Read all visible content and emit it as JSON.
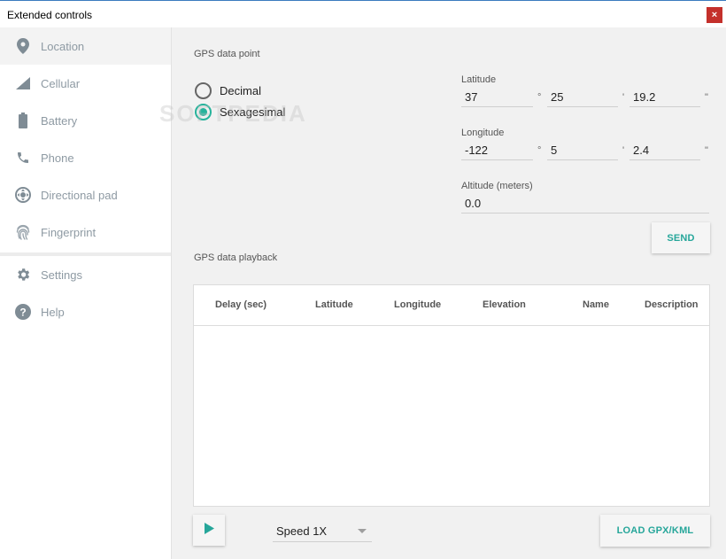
{
  "window": {
    "title": "Extended controls",
    "close_label": "×"
  },
  "sidebar": {
    "items": [
      {
        "label": "Location",
        "icon": "location-pin-icon",
        "active": true
      },
      {
        "label": "Cellular",
        "icon": "signal-icon"
      },
      {
        "label": "Battery",
        "icon": "battery-icon"
      },
      {
        "label": "Phone",
        "icon": "phone-icon"
      },
      {
        "label": "Directional pad",
        "icon": "dpad-icon"
      },
      {
        "label": "Fingerprint",
        "icon": "fingerprint-icon"
      }
    ],
    "secondary": [
      {
        "label": "Settings",
        "icon": "gear-icon"
      },
      {
        "label": "Help",
        "icon": "help-icon"
      }
    ]
  },
  "gps_point": {
    "title": "GPS data point",
    "format_options": {
      "decimal": "Decimal",
      "sexagesimal": "Sexagesimal"
    },
    "selected_format": "Sexagesimal",
    "latitude": {
      "label": "Latitude",
      "deg": "37",
      "min": "25",
      "sec": "19.2"
    },
    "longitude": {
      "label": "Longitude",
      "deg": "-122",
      "min": "5",
      "sec": "2.4"
    },
    "altitude": {
      "label": "Altitude (meters)",
      "value": "0.0"
    },
    "units": {
      "deg": "°",
      "min": "'",
      "sec": "\""
    },
    "send_label": "SEND"
  },
  "playback": {
    "title": "GPS data playback",
    "columns": [
      "Delay (sec)",
      "Latitude",
      "Longitude",
      "Elevation",
      "Name",
      "Description"
    ],
    "rows": [],
    "speed": "Speed 1X",
    "load_label": "LOAD GPX/KML"
  },
  "watermark": "SOFTPEDIA",
  "colors": {
    "accent": "#26a69a",
    "close": "#c4302b",
    "nav_text": "#8e9aa3"
  }
}
